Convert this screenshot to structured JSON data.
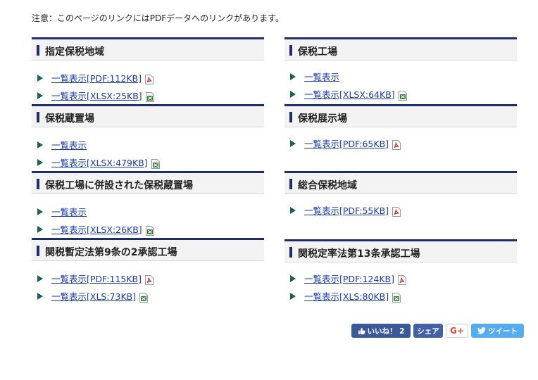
{
  "notice": "注意：このページのリンクにはPDFデータへのリンクがあります。",
  "columns": [
    {
      "sections": [
        {
          "title": "指定保税地域",
          "items": [
            {
              "label": "一覧表示[PDF:112KB]",
              "icon": "pdf"
            },
            {
              "label": "一覧表示[XLSX:25KB]",
              "icon": "excel"
            }
          ]
        },
        {
          "title": "保税蔵置場",
          "items": [
            {
              "label": "一覧表示",
              "icon": "none"
            },
            {
              "label": "一覧表示[XLSX:479KB]",
              "icon": "excel"
            }
          ]
        },
        {
          "title": "保税工場に併設された保税蔵置場",
          "items": [
            {
              "label": "一覧表示",
              "icon": "none"
            },
            {
              "label": "一覧表示[XLSX:26KB]",
              "icon": "excel"
            }
          ]
        },
        {
          "title": "関税暫定法第9条の2承認工場",
          "items": [
            {
              "label": "一覧表示[PDF:115KB]",
              "icon": "pdf"
            },
            {
              "label": "一覧表示[XLS:73KB]",
              "icon": "excel"
            }
          ]
        }
      ]
    },
    {
      "sections": [
        {
          "title": "保税工場",
          "items": [
            {
              "label": "一覧表示",
              "icon": "none"
            },
            {
              "label": "一覧表示[XLSX:64KB]",
              "icon": "excel"
            }
          ]
        },
        {
          "title": "保税展示場",
          "items": [
            {
              "label": "一覧表示[PDF:65KB]",
              "icon": "pdf"
            }
          ]
        },
        {
          "title": "総合保税地域",
          "items": [
            {
              "label": "一覧表示[PDF:55KB]",
              "icon": "pdf"
            }
          ]
        },
        {
          "title": "関税定率法第13条承認工場",
          "items": [
            {
              "label": "一覧表示[PDF:124KB]",
              "icon": "pdf"
            },
            {
              "label": "一覧表示[XLS:80KB]",
              "icon": "excel"
            }
          ]
        }
      ]
    }
  ],
  "share": {
    "facebook": "いいね！ 2",
    "hatena": "シェア",
    "googleplus": "G+",
    "twitter": "ツイート"
  },
  "colors": {
    "accent": "#1e2d6b",
    "link": "#1a3aa8",
    "pdf": "#c62828",
    "excel": "#2e7d32"
  }
}
